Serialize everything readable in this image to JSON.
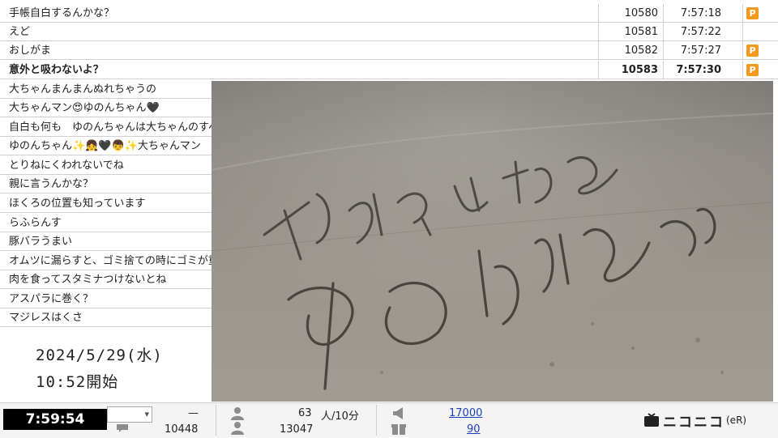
{
  "comments": [
    {
      "text": "手帳自白するんかな？",
      "no": "10580",
      "time": "7:57:18",
      "premium": true
    },
    {
      "text": "えど",
      "no": "10581",
      "time": "7:57:22",
      "premium": false
    },
    {
      "text": "おしがま",
      "no": "10582",
      "time": "7:57:27",
      "premium": true
    },
    {
      "text": "意外と吸わないよ？",
      "no": "10583",
      "time": "7:57:30",
      "premium": true,
      "bold": true
    },
    {
      "text": "大ちゃんまんまんぬれちゃうの"
    },
    {
      "text": "大ちゃんマン😍ゆのんちゃん🖤"
    },
    {
      "text": "自白も何も　ゆのんちゃんは大ちゃんのすべ"
    },
    {
      "text": "ゆのんちゃん✨👧🖤👦✨大ちゃんマン"
    },
    {
      "text": "とりねにくわれないでね"
    },
    {
      "text": "親に言うんかな？"
    },
    {
      "text": "ほくろの位置も知っています"
    },
    {
      "text": "らふらんす"
    },
    {
      "text": "豚バラうまい"
    },
    {
      "text": "オムツに漏らすと、ゴミ捨ての時にゴミが重く"
    },
    {
      "text": "肉を食ってスタミナつけないとね"
    },
    {
      "text": "アスパラに巻く？"
    },
    {
      "text": "マジレスはくさ"
    }
  ],
  "premium_badge": "P",
  "start": {
    "date": "2024/5/29(水)",
    "time": "10:52開始"
  },
  "footer": {
    "clock": "7:59:54",
    "dash": "—",
    "comment_count": "10448",
    "viewers_label_value": "63",
    "viewers_unit": "人/10分",
    "total_viewers": "13047",
    "ad_points": "17000",
    "gift_points": "90",
    "logo_text": "ニコニコ",
    "logo_suffix": "(eR)"
  },
  "video": {
    "sand_text_line1": "大ちゃんマンの",
    "sand_text_line2": "ゆのんちゃん"
  },
  "colors": {
    "premium": "#f39a1c",
    "link": "#1a3fbf",
    "clock_bg": "#000000"
  }
}
